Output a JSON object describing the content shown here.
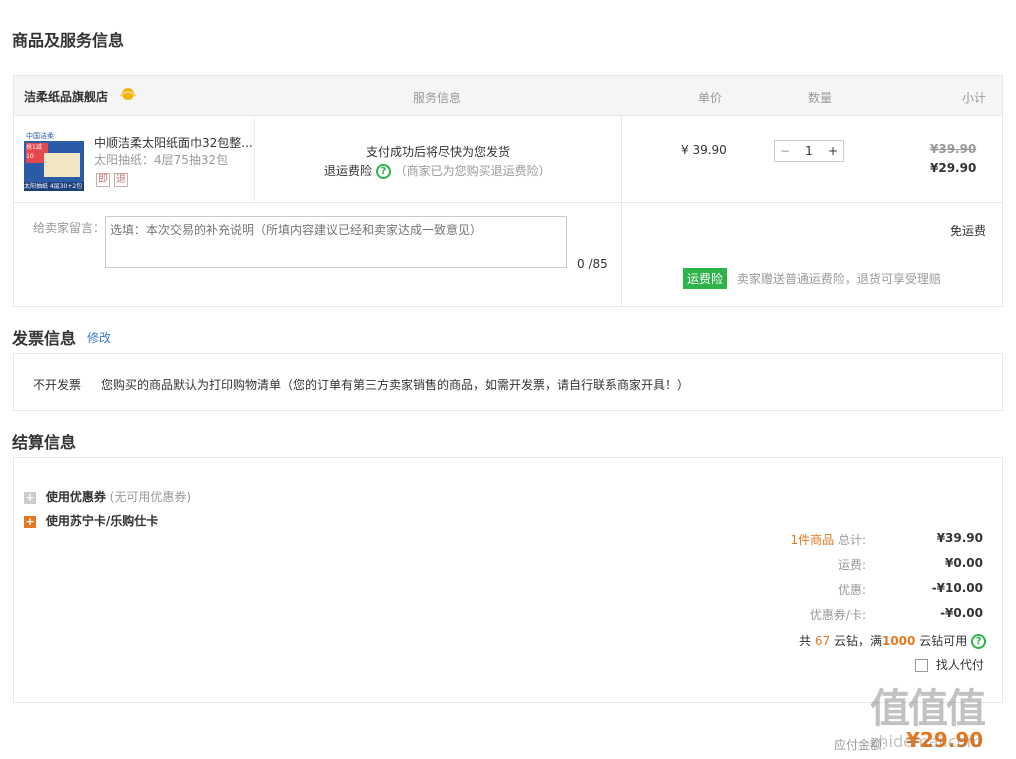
{
  "sections": {
    "goods_title": "商品及服务信息",
    "invoice_title": "发票信息",
    "invoice_edit": "修改",
    "settle_title": "结算信息"
  },
  "store": {
    "name": "洁柔纸品旗舰店",
    "col_service": "服务信息",
    "col_unit_price": "单价",
    "col_quantity": "数量",
    "col_subtotal": "小计"
  },
  "product": {
    "name": "中顺洁柔太阳纸面巾32包整...",
    "spec": "太阳抽纸：4层75抽32包",
    "tag1": "即",
    "tag2": "退",
    "image_badge_top": "中国洁柔",
    "image_badge_mid": "抢1减10",
    "image_bottom": "太阳抽纸 4层30+2包",
    "service_line": "支付成功后将尽快为您发货",
    "return_insurance": "退运费险",
    "return_insurance_note": "（商家已为您购买退运费险）",
    "unit_price": "¥ 39.90",
    "quantity": "1",
    "minus": "−",
    "plus": "+",
    "original_subtotal": "¥39.90",
    "subtotal": "¥29.90"
  },
  "message": {
    "label": "给卖家留言：",
    "placeholder": "选填：本次交易的补充说明（所填内容建议已经和卖家达成一致意见）",
    "counter": "0 /85",
    "shipping": "免运费",
    "insurance_badge": "运费险",
    "insurance_text": "卖家赠送普通运费险，退货可享受理赔"
  },
  "invoice": {
    "type": "不开发票",
    "note": "您购买的商品默认为打印购物清单（您的订单有第三方卖家销售的商品，如需开发票，请自行联系商家开具！）"
  },
  "settlement": {
    "coupon_label": "使用优惠券",
    "coupon_note": "(无可用优惠券)",
    "card_label": "使用苏宁卡/乐购仕卡",
    "items_count": "1件商品",
    "total_label": "总计:",
    "total_value": "¥39.90",
    "shipping_label": "运费:",
    "shipping_value": "¥0.00",
    "discount_label": "优惠:",
    "discount_value": "-¥10.00",
    "coupon_card_label": "优惠券/卡:",
    "coupon_card_value": "-¥0.00",
    "diamond_prefix": "共",
    "diamond_count": "67",
    "diamond_mid": "云钻，满",
    "diamond_threshold": "1000",
    "diamond_suffix": "云钻可用",
    "proxy_pay": "找人代付",
    "pay_label": "应付金额:",
    "pay_value": "¥29.90"
  },
  "watermark": {
    "logo": "值值值",
    "text": "zhidemai.com"
  },
  "colors": {
    "orange": "#e4771f",
    "green": "#2cb34a",
    "link": "#3a7bd5"
  }
}
